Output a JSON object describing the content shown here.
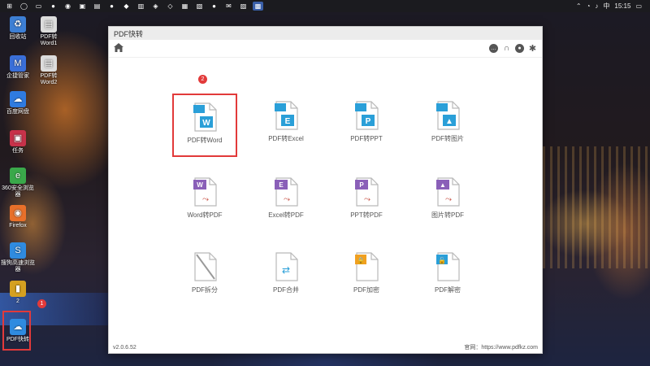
{
  "taskbar": {
    "items": [
      "⊞",
      "◯",
      "▭",
      "●",
      "◉",
      "▣",
      "▤",
      "●",
      "◆",
      "▥",
      "◈",
      "◇",
      "▦",
      "▧",
      "●",
      "✉",
      "▨",
      "▩"
    ],
    "tray": {
      "ime": "中",
      "time": "15:15"
    }
  },
  "desktop": {
    "icons": [
      {
        "label": "回收站",
        "glyph": "♻",
        "color": "#3d7fd4"
      },
      {
        "label": "PDF转\nWord1",
        "glyph": "▤",
        "color": "#dcdcdc"
      },
      {
        "label": "企捷管家",
        "glyph": "M",
        "color": "#3a6fd8"
      },
      {
        "label": "PDF转\nWord2",
        "glyph": "▤",
        "color": "#dcdcdc"
      },
      {
        "label": "百度网盘",
        "glyph": "☁",
        "color": "#2f7be0"
      },
      {
        "label": "任务",
        "glyph": "▣",
        "color": "#c8324a"
      },
      {
        "label": "360安全浏览器",
        "glyph": "e",
        "color": "#3aa84a"
      },
      {
        "label": "Firefox",
        "glyph": "◉",
        "color": "#e8702a"
      },
      {
        "label": "搜狗高速浏览器",
        "glyph": "S",
        "color": "#2f8be0"
      },
      {
        "label": "2",
        "glyph": "▮",
        "color": "#d4a020"
      },
      {
        "label": "PDF快转",
        "glyph": "☁",
        "color": "#2f8be0"
      }
    ],
    "step_badges": [
      "1",
      "2"
    ]
  },
  "window": {
    "title": "PDF快转",
    "home_icon": "home-icon",
    "toolbar_icons": [
      "chat-icon",
      "headset-icon",
      "user-icon",
      "gear-icon"
    ],
    "tiles": [
      {
        "label": "PDF转Word",
        "badge": "W",
        "accent": "#2a9fd8",
        "kind": "pdf"
      },
      {
        "label": "PDF转Excel",
        "badge": "E",
        "accent": "#2a9fd8",
        "kind": "pdf"
      },
      {
        "label": "PDF转PPT",
        "badge": "P",
        "accent": "#2a9fd8",
        "kind": "pdf"
      },
      {
        "label": "PDF转图片",
        "badge": "▲",
        "accent": "#2a9fd8",
        "kind": "pdf"
      },
      {
        "label": "Word转PDF",
        "badge": "W",
        "accent": "#8a5fb8",
        "kind": "to"
      },
      {
        "label": "Excel转PDF",
        "badge": "E",
        "accent": "#8a5fb8",
        "kind": "to"
      },
      {
        "label": "PPT转PDF",
        "badge": "P",
        "accent": "#8a5fb8",
        "kind": "to"
      },
      {
        "label": "图片转PDF",
        "badge": "▲",
        "accent": "#8a5fb8",
        "kind": "to"
      },
      {
        "label": "PDF拆分",
        "badge": "",
        "accent": "#9a9a9a",
        "kind": "split"
      },
      {
        "label": "PDF合并",
        "badge": "",
        "accent": "#2a9fd8",
        "kind": "merge"
      },
      {
        "label": "PDF加密",
        "badge": "🔒",
        "accent": "#f0a020",
        "kind": "lock"
      },
      {
        "label": "PDF解密",
        "badge": "🔓",
        "accent": "#2a9fd8",
        "kind": "unlock"
      }
    ],
    "version": "v2.0.6.52",
    "site_label": "官网：",
    "site_url": "https://www.pdfkz.com"
  },
  "colors": {
    "selection": "#e23a3a",
    "taskbar": "#1b1b1f"
  }
}
